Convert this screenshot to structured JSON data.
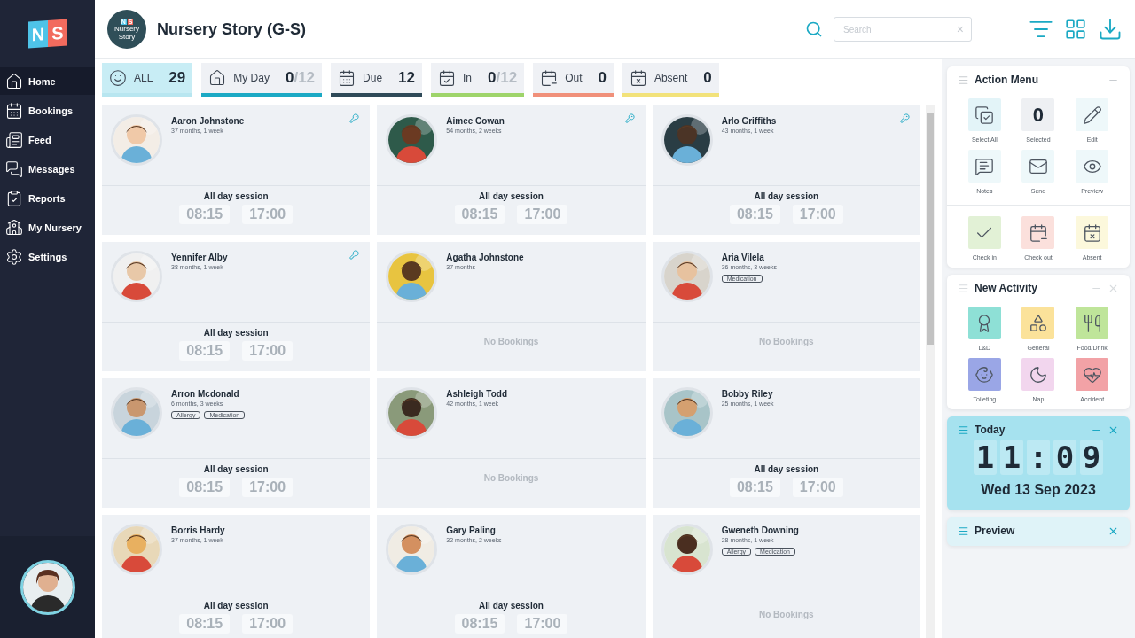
{
  "brand": {
    "logo_letters": [
      "N",
      "S"
    ]
  },
  "sidebar": {
    "items": [
      {
        "label": "Home",
        "selected": true
      },
      {
        "label": "Bookings",
        "selected": false
      },
      {
        "label": "Feed",
        "selected": false
      },
      {
        "label": "Messages",
        "selected": false
      },
      {
        "label": "Reports",
        "selected": false
      },
      {
        "label": "My Nursery",
        "selected": false
      },
      {
        "label": "Settings",
        "selected": false
      }
    ]
  },
  "header": {
    "badge_letters": [
      "N",
      "S"
    ],
    "badge_text": "Nursery Story",
    "title": "Nursery Story (G-S)",
    "search": {
      "placeholder": "Search",
      "clear": "×"
    }
  },
  "tabs": [
    {
      "label": "ALL",
      "count": "29",
      "selected": true,
      "color": "#b8e6f0"
    },
    {
      "label": "My Day",
      "count": "0",
      "total": "/12",
      "selected": false,
      "color": "#1ba9c4"
    },
    {
      "label": "Due",
      "count": "12",
      "selected": false,
      "color": "#2f4a58"
    },
    {
      "label": "In",
      "count": "0",
      "total": "/12",
      "selected": false,
      "color": "#9ed46a"
    },
    {
      "label": "Out",
      "count": "0",
      "selected": false,
      "color": "#f0907a"
    },
    {
      "label": "Absent",
      "count": "0",
      "selected": false,
      "color": "#f2e27a"
    }
  ],
  "children": [
    {
      "name": "Aaron Johnstone",
      "age": "37 months, 1 week",
      "key": true,
      "kind": "session",
      "session": "All day session",
      "times": [
        "08:15",
        "17:00"
      ]
    },
    {
      "name": "Aimee Cowan",
      "age": "54 months, 2 weeks",
      "key": true,
      "kind": "session",
      "session": "All day session",
      "times": [
        "08:15",
        "17:00"
      ]
    },
    {
      "name": "Arlo Griffiths",
      "age": "43 months, 1 week",
      "key": true,
      "kind": "session",
      "session": "All day session",
      "times": [
        "08:15",
        "17:00"
      ]
    },
    {
      "name": "Yennifer Alby",
      "age": "38 months, 1 week",
      "key": true,
      "kind": "session",
      "session": "All day session",
      "times": [
        "08:15",
        "17:00"
      ]
    },
    {
      "name": "Agatha Johnstone",
      "age": "37 months",
      "key": false,
      "kind": "none",
      "status": "No Bookings"
    },
    {
      "name": "Aria Vilela",
      "age": "36 months, 3 weeks",
      "tags": [
        "Medication"
      ],
      "key": false,
      "kind": "none",
      "status": "No Bookings"
    },
    {
      "name": "Arron Mcdonald",
      "age": "6 months, 3 weeks",
      "tags": [
        "Allergy",
        "Medication"
      ],
      "key": false,
      "kind": "session",
      "session": "All day session",
      "times": [
        "08:15",
        "17:00"
      ]
    },
    {
      "name": "Ashleigh Todd",
      "age": "42 months, 1 week",
      "key": false,
      "kind": "none",
      "status": "No Bookings"
    },
    {
      "name": "Bobby Riley",
      "age": "25 months, 1 week",
      "key": false,
      "kind": "session",
      "session": "All day session",
      "times": [
        "08:15",
        "17:00"
      ]
    },
    {
      "name": "Borris Hardy",
      "age": "37 months, 1 week",
      "key": false,
      "kind": "session",
      "session": "All day session",
      "times": [
        "08:15",
        "17:00"
      ]
    },
    {
      "name": "Gary Paling",
      "age": "32 months, 2 weeks",
      "key": false,
      "kind": "session",
      "session": "All day session",
      "times": [
        "08:15",
        "17:00"
      ]
    },
    {
      "name": "Gweneth Downing",
      "age": "28 months, 1 week",
      "tags": [
        "Allergy",
        "Medication"
      ],
      "key": false,
      "kind": "none",
      "status": "No Bookings"
    }
  ],
  "action_menu": {
    "title": "Action Menu",
    "items": [
      {
        "label": "Select All",
        "color": "#e3f4f8"
      },
      {
        "label": "Selected",
        "value": "0",
        "color": "#eef0f3"
      },
      {
        "label": "Edit",
        "color": "#eef8fa"
      },
      {
        "label": "Notes",
        "color": "#eef8fa"
      },
      {
        "label": "Send",
        "color": "#eef8fa"
      },
      {
        "label": "Preview",
        "color": "#eef8fa"
      }
    ],
    "status_items": [
      {
        "label": "Check in",
        "color": "#e2f1d6"
      },
      {
        "label": "Check out",
        "color": "#fbe0dc"
      },
      {
        "label": "Absent",
        "color": "#fcf8dc"
      }
    ]
  },
  "new_activity": {
    "title": "New Activity",
    "closable": true,
    "items": [
      {
        "label": "L&D",
        "color": "#8ee0d6"
      },
      {
        "label": "General",
        "color": "#fbe29a"
      },
      {
        "label": "Food/Drink",
        "color": "#bfe59a"
      },
      {
        "label": "Toileting",
        "color": "#9aa6e6"
      },
      {
        "label": "Nap",
        "color": "#f2d6ee"
      },
      {
        "label": "Accident",
        "color": "#f2a2a6"
      }
    ]
  },
  "today": {
    "title": "Today",
    "closable": true,
    "time_digits": [
      "1",
      "1",
      ":",
      "0",
      "9"
    ],
    "date": "Wed 13 Sep 2023"
  },
  "preview": {
    "title": "Preview",
    "closable": true
  }
}
